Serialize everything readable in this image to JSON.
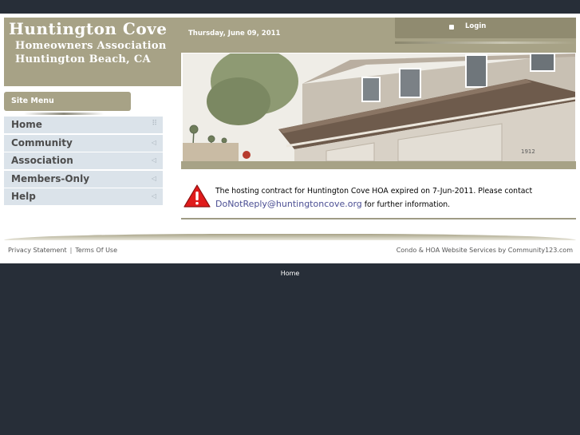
{
  "brand": {
    "title": "Huntington Cove",
    "subtitle": "Homeowners Association",
    "city": "Huntington Beach, CA"
  },
  "header": {
    "date": "Thursday, June 09, 2011",
    "login_label": "Login",
    "accent_color": "#a7a286"
  },
  "menu": {
    "heading": "Site Menu",
    "items": [
      {
        "label": "Home",
        "icon": "grip-icon"
      },
      {
        "label": "Community",
        "icon": "arrow-left-icon"
      },
      {
        "label": "Association",
        "icon": "arrow-left-icon"
      },
      {
        "label": "Members-Only",
        "icon": "arrow-left-icon"
      },
      {
        "label": "Help",
        "icon": "arrow-left-icon"
      }
    ]
  },
  "notice": {
    "line1": "The hosting contract for Huntington Cove HOA expired on 7-Jun-2011. Please contact",
    "email": "DoNotReply@huntingtoncove.org",
    "line2_suffix": " for further information.",
    "icon": "warning-icon"
  },
  "photo": {
    "house_number": "1912"
  },
  "footer": {
    "privacy": "Privacy Statement",
    "separator": "|",
    "terms": "Terms Of Use",
    "credit": "Condo & HOA Website Services by Community123.com",
    "bottom_home": "Home"
  }
}
